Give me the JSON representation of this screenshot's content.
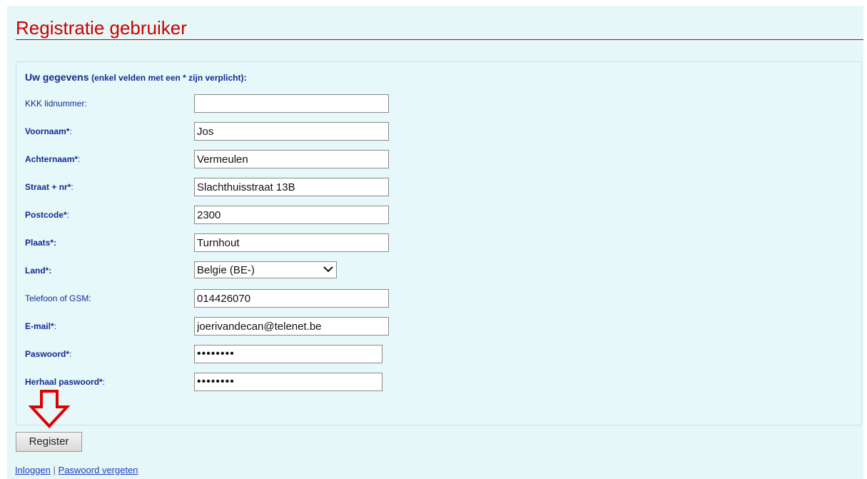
{
  "page": {
    "title": "Registratie gebruiker"
  },
  "form": {
    "heading_main": "Uw gegevens",
    "heading_note": "(enkel velden met een * zijn verplicht)",
    "heading_colon": ":",
    "fields": [
      {
        "label": "KKK lidnummer",
        "suffix": ":",
        "value": ""
      },
      {
        "label": "Voornaam*",
        "suffix": ":",
        "value": "Jos"
      },
      {
        "label": "Achternaam*",
        "suffix": ":",
        "value": "Vermeulen"
      },
      {
        "label": "Straat + nr*",
        "suffix": ":",
        "value": "Slachthuisstraat 13B"
      },
      {
        "label": "Postcode*",
        "suffix": ":",
        "value": "2300"
      },
      {
        "label": "Plaats*:",
        "suffix": "",
        "value": "Turnhout"
      },
      {
        "label": "Land*:",
        "suffix": "",
        "value": "Belgie (BE-)"
      },
      {
        "label": "Telefoon of GSM",
        "suffix": ":",
        "value": "014426070"
      },
      {
        "label": "E-mail*",
        "suffix": ":",
        "value": "joerivandecan@telenet.be"
      },
      {
        "label": "Paswoord*",
        "suffix": ":",
        "value": "••••••••"
      },
      {
        "label": "Herhaal paswoord*",
        "suffix": ":",
        "value": "••••••••"
      }
    ]
  },
  "actions": {
    "register_label": "Register"
  },
  "links": {
    "login": "Inloggen",
    "separator": "|",
    "forgot_password": "Paswoord vergeten"
  },
  "colors": {
    "title": "#cc0000",
    "label": "#152b8f",
    "background": "#e6f7f8",
    "arrow": "#e00000"
  },
  "icons": {
    "select_chevron": "chevron-down-icon",
    "pointer_arrow": "down-arrow-icon"
  }
}
